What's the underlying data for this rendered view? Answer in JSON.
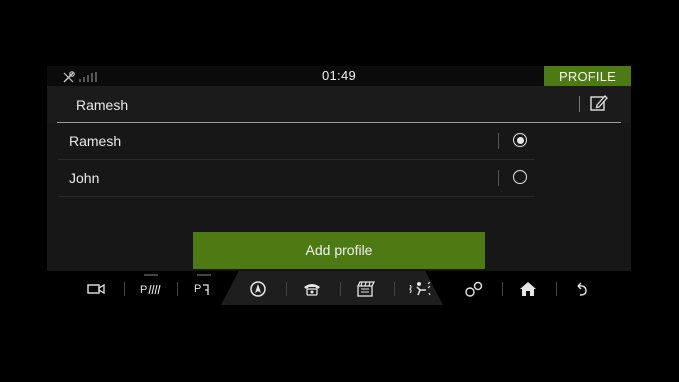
{
  "status_bar": {
    "time": "01:49",
    "section": "PROFILE",
    "icons": [
      "wrench-off-icon",
      "signal-bars-icon"
    ]
  },
  "header": {
    "current_profile": "Ramesh",
    "edit_icon": "edit-icon"
  },
  "profiles": [
    {
      "name": "Ramesh",
      "selected": true
    },
    {
      "name": "John",
      "selected": false
    }
  ],
  "add_profile_label": "Add profile",
  "colors": {
    "accent": "#4e7a14",
    "panel": "#171717",
    "background": "#000000"
  },
  "nav_bar": [
    {
      "icon": "camera-icon"
    },
    {
      "icon": "park-distance-icon"
    },
    {
      "icon": "park-assist-icon"
    },
    {
      "icon": "navigation-icon"
    },
    {
      "icon": "phone-icon"
    },
    {
      "icon": "media-icon"
    },
    {
      "icon": "climate-icon"
    },
    {
      "icon": "apps-icon"
    },
    {
      "icon": "home-icon"
    },
    {
      "icon": "back-icon"
    }
  ]
}
